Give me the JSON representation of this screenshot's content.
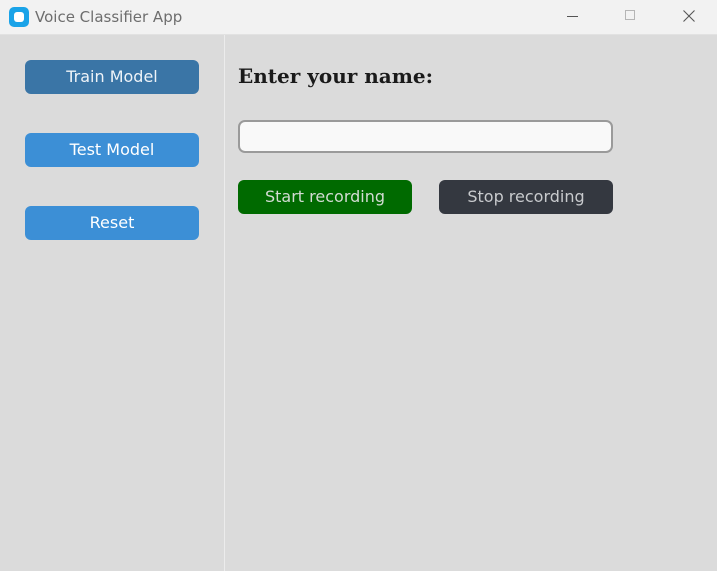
{
  "window": {
    "title": "Voice Classifier App",
    "icon": "app-icon",
    "controls": [
      "minimize-icon",
      "maximize-icon",
      "close-icon"
    ]
  },
  "sidebar": {
    "buttons": [
      {
        "label": "Train Model",
        "color": "#3a75a6"
      },
      {
        "label": "Test Model",
        "color": "#3c8fd6"
      },
      {
        "label": "Reset",
        "color": "#3c8fd6"
      }
    ]
  },
  "main": {
    "prompt": "Enter your name:",
    "name_input": {
      "value": "",
      "placeholder": ""
    },
    "start_button": {
      "label": "Start recording",
      "color": "#006a00"
    },
    "stop_button": {
      "label": "Stop recording",
      "color": "#343840"
    }
  }
}
